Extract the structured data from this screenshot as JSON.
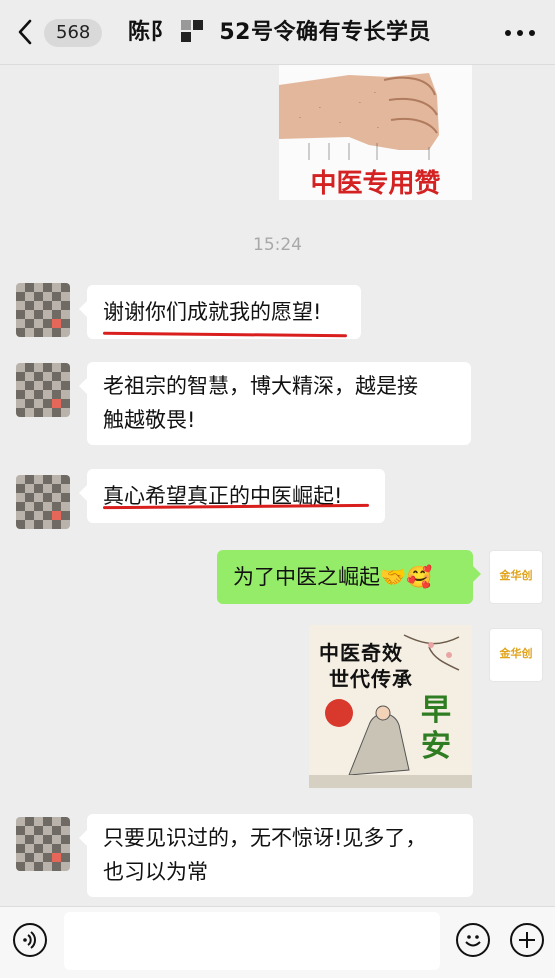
{
  "header": {
    "unread_count": "568",
    "title_prefix": "陈阝",
    "title_suffix": "52号令确有专长学员"
  },
  "messages": {
    "time": "15:24",
    "top_image_caption": "中医专用赞",
    "m1": "谢谢你们成就我的愿望!",
    "m2_line1": "老祖宗的智慧，博大精深，越是接",
    "m2_line2": "触越敬畏!",
    "m3": "真心希望真正的中医崛起!",
    "m4": "为了中医之崛起🤝🥰",
    "poster_line1": "中医奇效",
    "poster_line2": "世代传承",
    "poster_big": "早安",
    "m5_line1": "只要见识过的，无不惊讶!见多了，",
    "m5_line2": "也习以为常"
  },
  "self_avatar_text": "金华创",
  "colors": {
    "bg": "#ededed",
    "bubble_self": "#95ec69",
    "bubble_other": "#ffffff",
    "underline": "#d91e1e"
  }
}
